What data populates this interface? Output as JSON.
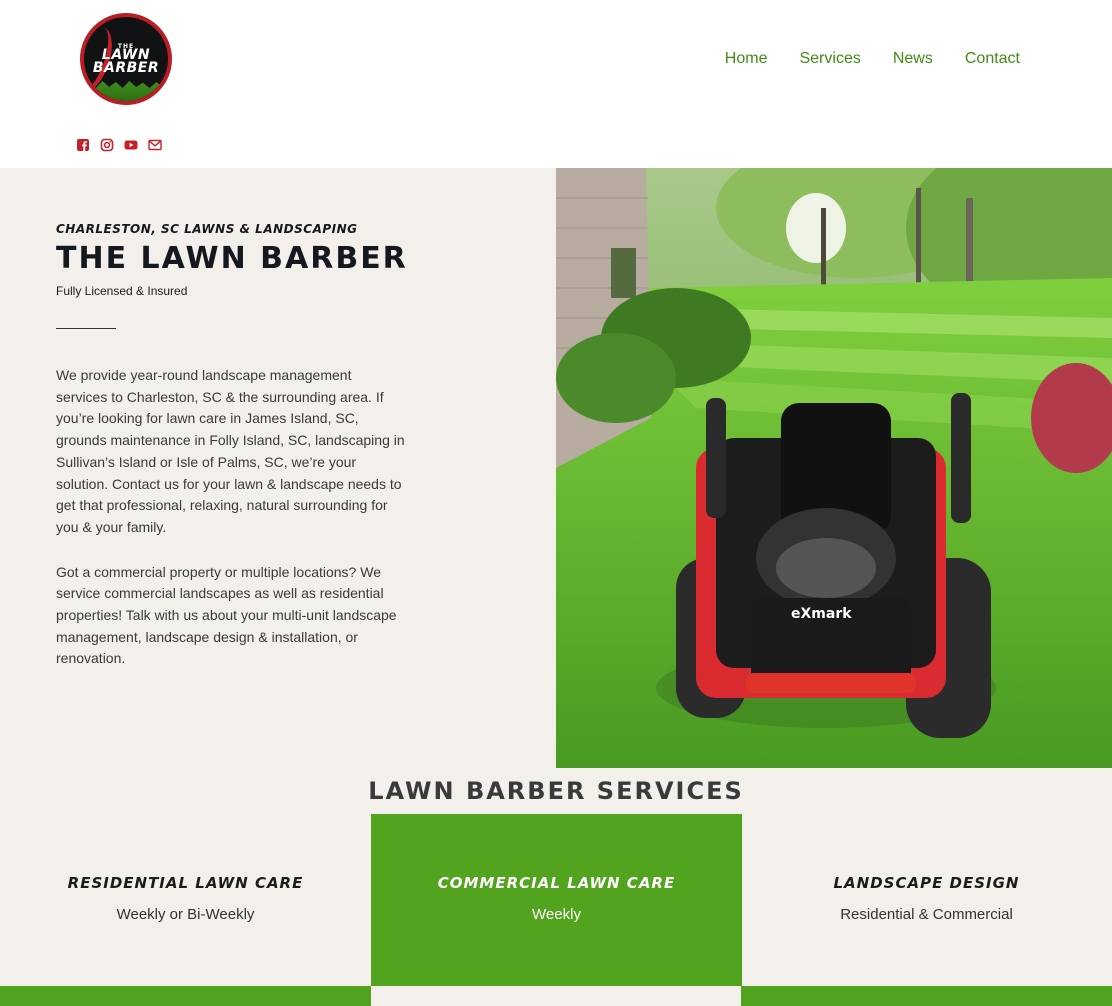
{
  "header": {
    "logo": {
      "top_text": "THE",
      "line1": "LAWN",
      "line2": "BARBER"
    },
    "nav": [
      {
        "label": "Home"
      },
      {
        "label": "Services"
      },
      {
        "label": "News"
      },
      {
        "label": "Contact"
      }
    ],
    "social_icons": [
      "facebook-icon",
      "instagram-icon",
      "youtube-icon",
      "email-icon"
    ]
  },
  "hero": {
    "eyebrow": "Charleston, SC Lawns & Landscaping",
    "title": "The Lawn Barber",
    "subtitle": "Fully Licensed & Insured",
    "paragraph1": "We provide year-round landscape management services to Charleston, SC & the surrounding area. If you’re looking for lawn care in James Island, SC, grounds maintenance in Folly Island, SC, landscaping in Sullivan’s Island or Isle of Palms, SC, we’re your solution. Contact us for your lawn & landscape needs to get that professional, relaxing, natural surrounding for you & your family.",
    "paragraph2": "Got a commercial property or multiple locations? We service commercial landscapes as well as residential properties! Talk with us about your multi-unit landscape management, landscape design & installation, or renovation.",
    "mower_brand": "eXmark"
  },
  "services": {
    "title": "Lawn Barber Services",
    "items": [
      {
        "name": "Residential Lawn Care",
        "detail": "Weekly or Bi-Weekly"
      },
      {
        "name": "Commercial Lawn Care",
        "detail": "Weekly"
      },
      {
        "name": "Landscape Design",
        "detail": "Residential & Commercial"
      }
    ]
  },
  "colors": {
    "accent_green": "#52a31d",
    "nav_green": "#3f8d15",
    "social_red": "#c8202a",
    "hero_bg": "#f3efea",
    "heading_dark": "#14181f"
  }
}
